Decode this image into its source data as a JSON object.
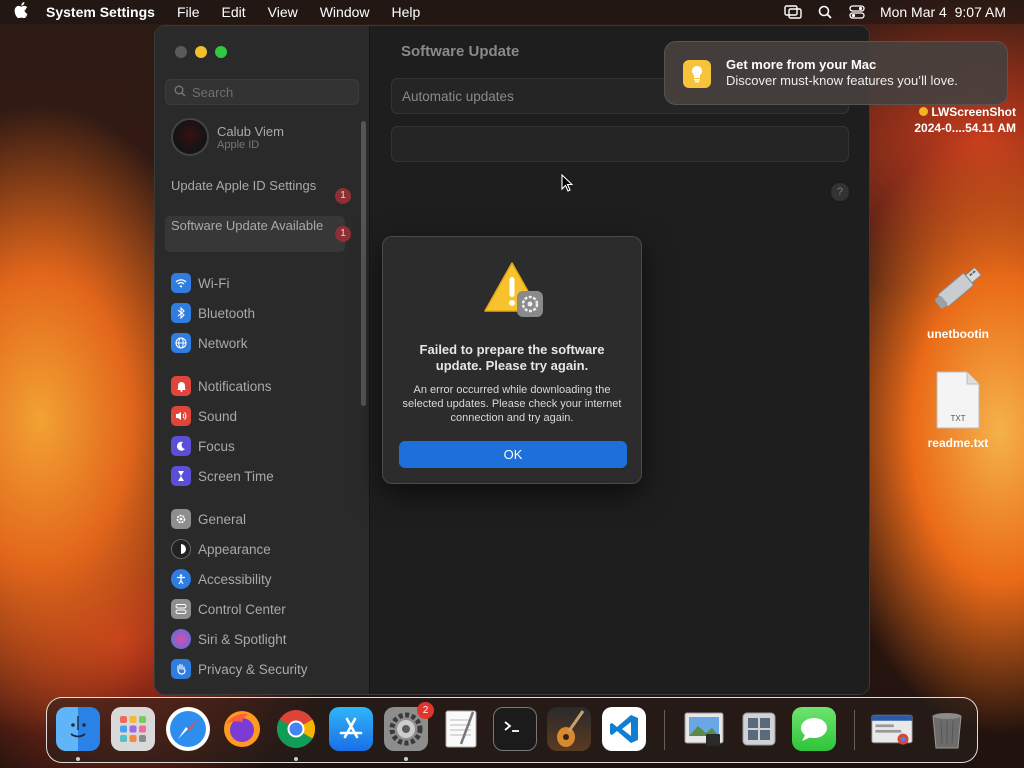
{
  "menubar": {
    "app_name": "System Settings",
    "menus": [
      "File",
      "Edit",
      "View",
      "Window",
      "Help"
    ],
    "datetime": "Mon Mar 4  9:07 AM"
  },
  "sidebar": {
    "search_placeholder": "Search",
    "account": {
      "name": "Calub Viem",
      "subtitle": "Apple ID"
    },
    "notices": [
      {
        "label": "Update Apple ID Settings",
        "badge": "1"
      },
      {
        "label": "Software Update Available",
        "badge": "1"
      }
    ],
    "items": [
      {
        "label": "Wi-Fi",
        "icon": "wifi-icon",
        "color": "#2f7de1"
      },
      {
        "label": "Bluetooth",
        "icon": "bluetooth-icon",
        "color": "#2f7de1"
      },
      {
        "label": "Network",
        "icon": "globe-icon",
        "color": "#2f7de1"
      },
      {
        "label": "Notifications",
        "icon": "bell-icon",
        "color": "#e0453a"
      },
      {
        "label": "Sound",
        "icon": "speaker-icon",
        "color": "#e0453a"
      },
      {
        "label": "Focus",
        "icon": "moon-icon",
        "color": "#5b4fd6"
      },
      {
        "label": "Screen Time",
        "icon": "hourglass-icon",
        "color": "#5b4fd6"
      },
      {
        "label": "General",
        "icon": "gear-icon",
        "color": "#8e8e8e"
      },
      {
        "label": "Appearance",
        "icon": "appearance-icon",
        "color": "#222222"
      },
      {
        "label": "Accessibility",
        "icon": "accessibility-icon",
        "color": "#2f7de1"
      },
      {
        "label": "Control Center",
        "icon": "control-center-icon",
        "color": "#8e8e8e"
      },
      {
        "label": "Siri & Spotlight",
        "icon": "siri-icon",
        "color": "#b03ca0"
      },
      {
        "label": "Privacy & Security",
        "icon": "hand-icon",
        "color": "#2f7de1"
      }
    ]
  },
  "main": {
    "title": "Software Update",
    "automatic_updates": "Automatic updates",
    "help": "?"
  },
  "alert": {
    "title": "Failed to prepare the software update. Please try again.",
    "message": "An error occurred while downloading the selected updates. Please check your internet connection and try again.",
    "ok": "OK"
  },
  "notification": {
    "title": "Get more from your Mac",
    "body": "Discover must-know features you’ll love."
  },
  "desktop": {
    "screenshot_line1": "LWScreenShot",
    "screenshot_line2": "2024-0....54.11 AM",
    "items": [
      {
        "label": "unetbootin"
      },
      {
        "label": "readme.txt",
        "file_tag": "TXT"
      }
    ]
  },
  "dock": {
    "apps": [
      "Finder",
      "Launchpad",
      "Safari",
      "Firefox",
      "Chrome",
      "App Store",
      "System Settings",
      "TextEdit",
      "Terminal",
      "GarageBand",
      "VS Code",
      "Preview",
      "Boot Camp Assistant",
      "Messages",
      "Downloads",
      "Trash"
    ],
    "system_settings_badge": "2"
  },
  "colors": {
    "accent": "#1d6fd9",
    "badge": "#8e2f34",
    "close": "#5a5a5a",
    "minimize": "#f4bf2e",
    "zoom": "#2fc840"
  }
}
